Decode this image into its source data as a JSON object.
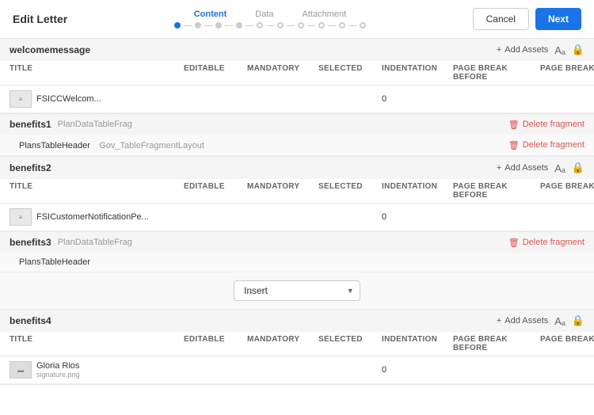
{
  "header": {
    "title": "Edit Letter",
    "cancel_label": "Cancel",
    "next_label": "Next",
    "steps": {
      "labels": [
        "Content",
        "Data",
        "Attachment"
      ],
      "active_index": 0,
      "dot_count": 10
    }
  },
  "sections": [
    {
      "id": "welcomemessage",
      "name": "welcomemessage",
      "subtitle": "",
      "type": "asset",
      "show_add_assets": true,
      "show_delete": false,
      "columns": [
        "TITLE",
        "EDITABLE",
        "MANDATORY",
        "SELECTED",
        "INDENTATION",
        "PAGE BREAK BEFORE",
        "PAGE BREAK AFTER",
        ""
      ],
      "rows": [
        {
          "title": "FSICCWelcom...",
          "subtitle": "",
          "indentation": "0",
          "editable": "",
          "mandatory": "",
          "selected": ""
        }
      ]
    },
    {
      "id": "benefits1",
      "name": "benefits1",
      "subtitle": "PlanDataTableFrag",
      "type": "fragment",
      "show_add_assets": false,
      "show_delete": true,
      "fragments": [
        {
          "name": "PlansTableHeader",
          "subtitle": "Gov_TableFragmentLayout"
        }
      ]
    },
    {
      "id": "benefits2",
      "name": "benefits2",
      "subtitle": "",
      "type": "asset",
      "show_add_assets": true,
      "show_delete": false,
      "columns": [
        "TITLE",
        "EDITABLE",
        "MANDATORY",
        "SELECTED",
        "INDENTATION",
        "PAGE BREAK BEFORE",
        "PAGE BREAK AFTER",
        ""
      ],
      "rows": [
        {
          "title": "FSICustomerNotificationPe...",
          "subtitle": "",
          "indentation": "0",
          "editable": "",
          "mandatory": "",
          "selected": ""
        }
      ]
    },
    {
      "id": "benefits3",
      "name": "benefits3",
      "subtitle": "PlanDataTableFrag",
      "type": "fragment",
      "show_add_assets": false,
      "show_delete": true,
      "fragments": [
        {
          "name": "PlansTableHeader",
          "subtitle": ""
        }
      ],
      "show_insert": true,
      "insert_placeholder": "Insert"
    },
    {
      "id": "benefits4",
      "name": "benefits4",
      "subtitle": "",
      "type": "asset",
      "show_add_assets": true,
      "show_delete": false,
      "columns": [
        "TITLE",
        "EDITABLE",
        "MANDATORY",
        "SELECTED",
        "INDENTATION",
        "PAGE BREAK BEFORE",
        "PAGE BREAK AFTER",
        ""
      ],
      "rows": [
        {
          "title": "Gloria Rios",
          "subtitle": "signature.png",
          "indentation": "0",
          "editable": "",
          "mandatory": "",
          "selected": ""
        }
      ]
    }
  ],
  "icons": {
    "plus": "+",
    "edit": "✎",
    "trash": "🗑",
    "chevron_right": "›",
    "add_icon": "+",
    "font_icon": "Aₐ",
    "lock_icon": "🔒",
    "trash_small": "🗑"
  }
}
